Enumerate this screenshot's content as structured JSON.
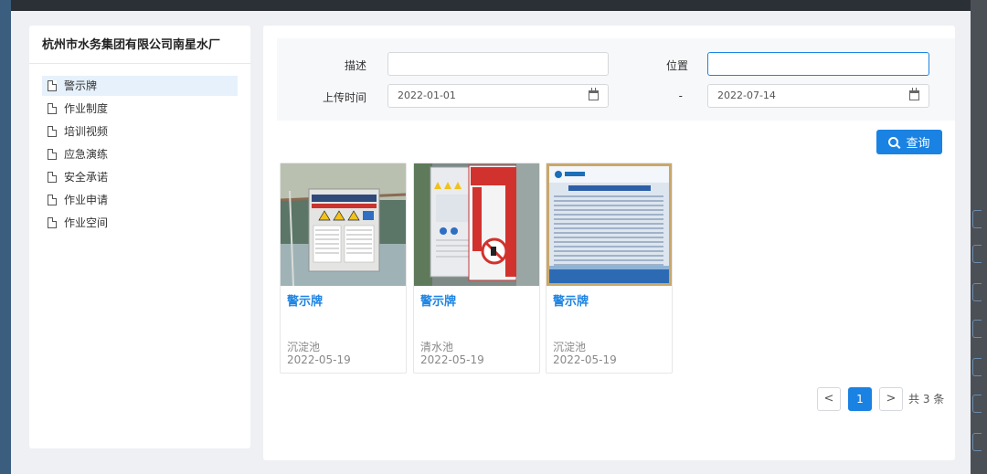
{
  "sidebar": {
    "title": "杭州市水务集团有限公司南星水厂",
    "items": [
      {
        "label": "警示牌"
      },
      {
        "label": "作业制度"
      },
      {
        "label": "培训视频"
      },
      {
        "label": "应急演练"
      },
      {
        "label": "安全承诺"
      },
      {
        "label": "作业申请"
      },
      {
        "label": "作业空间"
      }
    ]
  },
  "filter": {
    "desc_label": "描述",
    "desc_value": "",
    "location_label": "位置",
    "location_value": "",
    "upload_time_label": "上传时间",
    "start_date": "2022-01-01",
    "range_sep": "-",
    "end_date": "2022-07-14",
    "query_label": "查询"
  },
  "cards": [
    {
      "title": "警示牌",
      "location": "沉淀池",
      "date": "2022-05-19"
    },
    {
      "title": "警示牌",
      "location": "清水池",
      "date": "2022-05-19"
    },
    {
      "title": "警示牌",
      "location": "沉淀池",
      "date": "2022-05-19"
    }
  ],
  "pagination": {
    "prev": "<",
    "current": "1",
    "next": ">",
    "total_text": "共 3 条"
  },
  "colors": {
    "accent": "#1a82e2",
    "active_item_bg": "#e6f1fb",
    "panel_bg": "#eef0f3"
  }
}
